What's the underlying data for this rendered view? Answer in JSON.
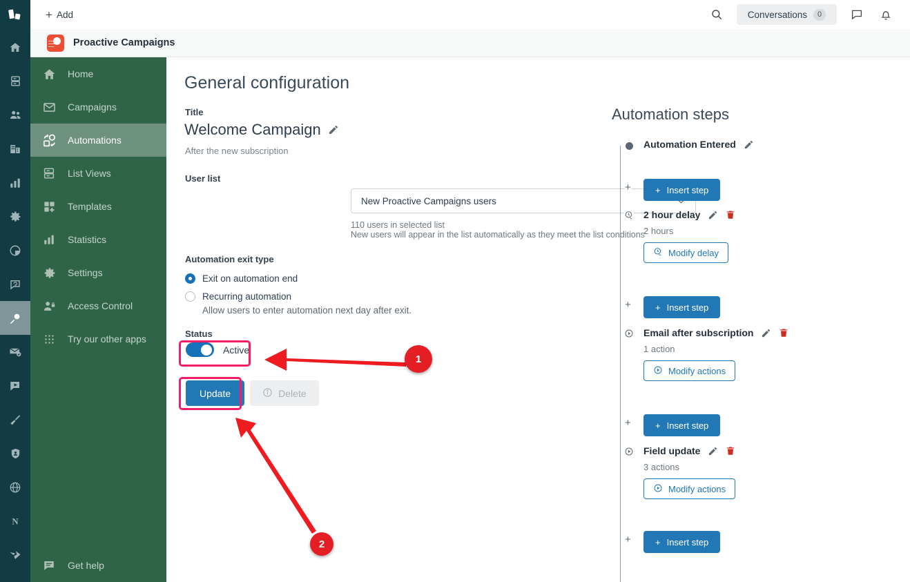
{
  "topbar": {
    "add_label": "Add",
    "search_icon": "search-icon",
    "conversations_label": "Conversations",
    "conversations_count": "0",
    "chat_icon": "chat-bubble-icon",
    "bell_icon": "bell-icon"
  },
  "app_header": {
    "title": "Proactive Campaigns",
    "icon": "proactive-campaigns-app-icon"
  },
  "rail": {
    "logo": "zoho-logo",
    "items": [
      {
        "icon": "home-icon",
        "selected": false
      },
      {
        "icon": "desk-icon",
        "selected": false
      },
      {
        "icon": "people-icon",
        "selected": false
      },
      {
        "icon": "building-icon",
        "selected": false
      },
      {
        "icon": "bar-chart-icon",
        "selected": false
      },
      {
        "icon": "gear-icon",
        "selected": false
      },
      {
        "icon": "pie-chart-icon",
        "selected": false
      },
      {
        "icon": "chat-refresh-icon",
        "selected": false
      },
      {
        "icon": "magic-wand-icon",
        "selected": true
      },
      {
        "icon": "mail-check-icon",
        "selected": false
      },
      {
        "icon": "video-chat-icon",
        "selected": false
      },
      {
        "icon": "broom-icon",
        "selected": false
      },
      {
        "icon": "shield-user-icon",
        "selected": false
      },
      {
        "icon": "globe-icon",
        "selected": false
      },
      {
        "icon": "letter-n-icon",
        "selected": false
      },
      {
        "icon": "arrow-brand-icon",
        "selected": false
      }
    ]
  },
  "sidebar": {
    "items": [
      {
        "label": "Home",
        "icon": "home-icon",
        "active": false
      },
      {
        "label": "Campaigns",
        "icon": "envelope-icon",
        "active": false
      },
      {
        "label": "Automations",
        "icon": "automations-icon",
        "active": true
      },
      {
        "label": "List Views",
        "icon": "list-views-icon",
        "active": false
      },
      {
        "label": "Templates",
        "icon": "templates-icon",
        "active": false
      },
      {
        "label": "Statistics",
        "icon": "statistics-icon",
        "active": false
      },
      {
        "label": "Settings",
        "icon": "gear-icon",
        "active": false
      },
      {
        "label": "Access Control",
        "icon": "access-control-icon",
        "active": false
      },
      {
        "label": "Try our other apps",
        "icon": "grid-dots-icon",
        "active": false
      }
    ],
    "bottom": {
      "label": "Get help",
      "icon": "help-chat-icon"
    }
  },
  "main": {
    "page_title": "General configuration",
    "title_label": "Title",
    "title_value": "Welcome Campaign",
    "title_edit_icon": "pencil-icon",
    "subtitle": "After the new subscription",
    "user_list_label": "User list",
    "user_list_value": "New Proactive Campaigns users",
    "user_list_chevron": "chevron-down-icon",
    "hint_users": "110 users in selected list",
    "hint_auto": "New users will appear in the list automatically as they meet the list conditions",
    "exit_type_label": "Automation exit type",
    "exit_options": [
      {
        "label": "Exit on automation end",
        "selected": true,
        "sub": ""
      },
      {
        "label": "Recurring automation",
        "selected": false,
        "sub": "Allow users to enter automation next day after exit."
      }
    ],
    "status_label": "Status",
    "toggle_label": "Active",
    "toggle_on": true,
    "update_label": "Update",
    "delete_label": "Delete",
    "delete_info_icon": "info-circle-icon"
  },
  "steps": {
    "title": "Automation steps",
    "insert_label": "Insert step",
    "items": [
      {
        "name": "Automation Entered",
        "marker": "dot-marker",
        "sub": null,
        "action_label": null,
        "action_icon": null,
        "editable": true,
        "deletable": false
      },
      {
        "name": "2 hour delay",
        "marker": "clock-icon",
        "sub": "2 hours",
        "action_label": "Modify delay",
        "action_icon": "clock-icon",
        "editable": true,
        "deletable": true
      },
      {
        "name": "Email after subscription",
        "marker": "play-circle-icon",
        "sub": "1 action",
        "action_label": "Modify actions",
        "action_icon": "play-circle-icon",
        "editable": true,
        "deletable": true
      },
      {
        "name": "Field update",
        "marker": "play-circle-icon",
        "sub": "3 actions",
        "action_label": "Modify actions",
        "action_icon": "play-circle-icon",
        "editable": true,
        "deletable": true
      }
    ]
  },
  "annotations": [
    {
      "number": "1",
      "target": "status-toggle"
    },
    {
      "number": "2",
      "target": "update-button"
    }
  ],
  "colors": {
    "rail_bg": "#123b43",
    "sidebar_bg": "#2f6449",
    "sidebar_active": "#6f9280",
    "accent_blue": "#2178b5",
    "toggle_on": "#1571b8",
    "danger_red": "#d02b20",
    "anno_pink": "#f31c68",
    "anno_red": "#e31e24",
    "app_icon": "#ea4e35"
  }
}
